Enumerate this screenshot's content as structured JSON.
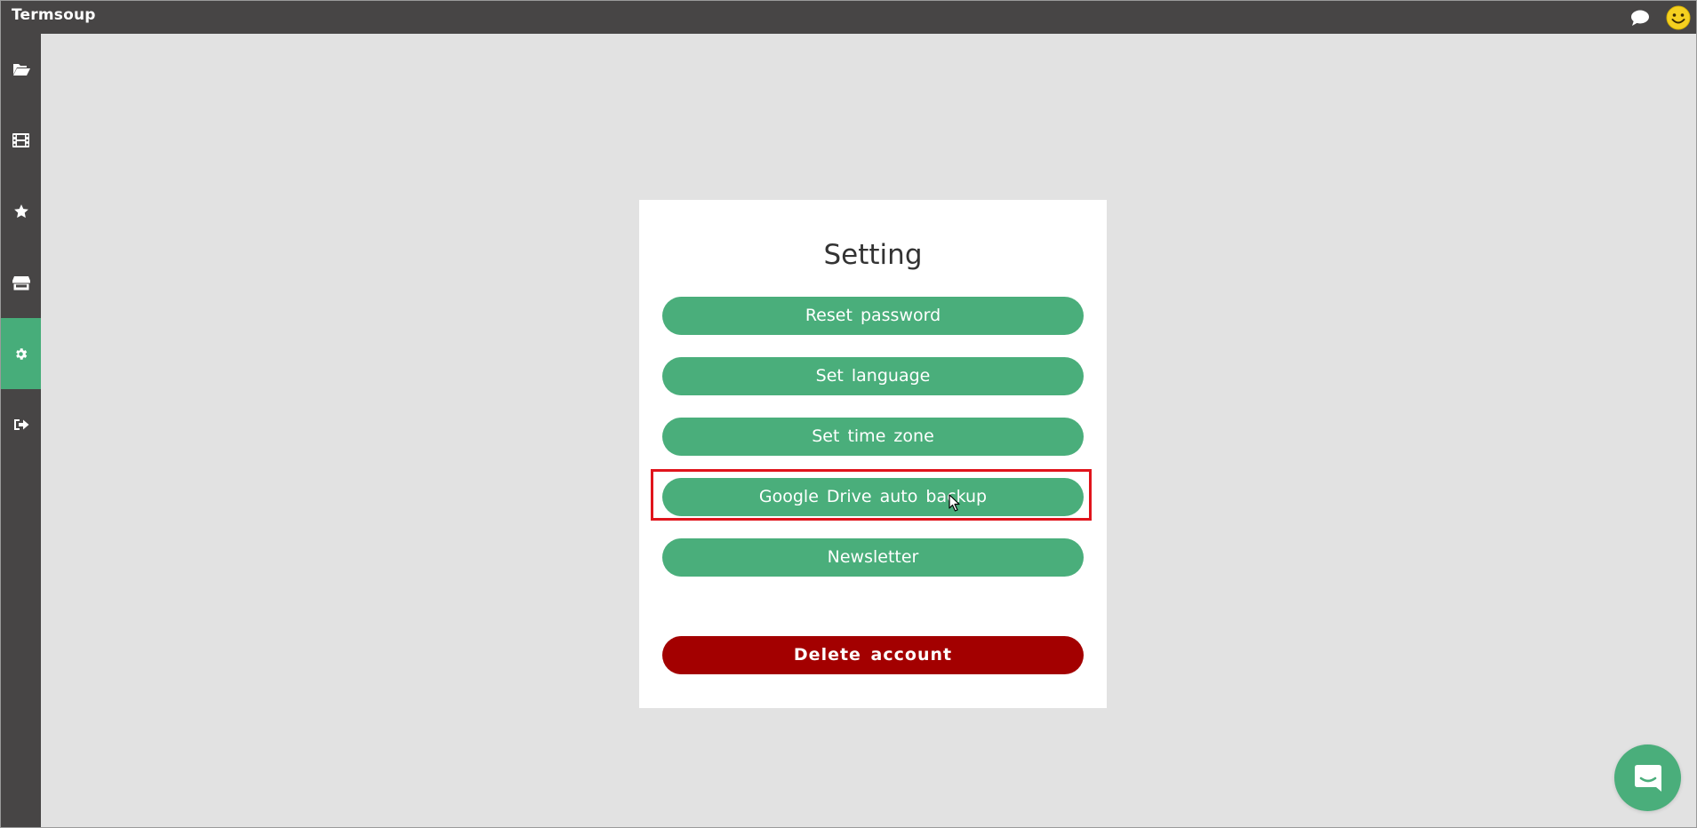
{
  "app": {
    "title": "Termsoup"
  },
  "topbar": {
    "icons": [
      "chat-bubble-icon",
      "smiley-icon"
    ]
  },
  "sidebar": {
    "items": [
      {
        "icon": "folder-open-icon",
        "active": false
      },
      {
        "icon": "film-icon",
        "active": false
      },
      {
        "icon": "star-icon",
        "active": false
      },
      {
        "icon": "store-icon",
        "active": false
      },
      {
        "icon": "gear-icon",
        "active": true
      },
      {
        "icon": "sign-out-icon",
        "active": false
      }
    ]
  },
  "settings": {
    "title": "Setting",
    "buttons": {
      "reset_password": "Reset password",
      "set_language": "Set language",
      "set_time_zone": "Set time zone",
      "google_drive_backup": "Google Drive auto backup",
      "newsletter": "Newsletter",
      "delete_account": "Delete account"
    }
  },
  "colors": {
    "bar": "#474545",
    "accent": "#4aae7b",
    "danger": "#a30000",
    "highlight": "#e0141c",
    "background": "#e2e2e2"
  },
  "chat_launcher": {
    "icon": "messenger-icon"
  }
}
